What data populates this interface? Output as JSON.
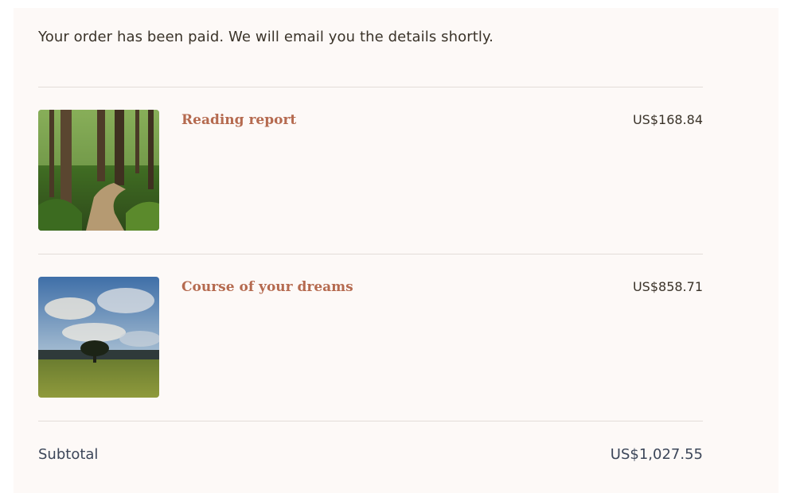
{
  "order": {
    "message": "Your order has been paid. We will email you the details shortly.",
    "items": [
      {
        "title": "Reading report",
        "price": "US$168.84",
        "image": "forest-path"
      },
      {
        "title": "Course of your dreams",
        "price": "US$858.71",
        "image": "tree-field-sky"
      }
    ],
    "subtotal_label": "Subtotal",
    "subtotal_value": "US$1,027.55"
  },
  "colors": {
    "accent": "#b56a4f",
    "card_bg": "#fdf9f7",
    "text": "#3a3329",
    "subtotal_text": "#3c4659",
    "divider": "#e3ddd9"
  }
}
